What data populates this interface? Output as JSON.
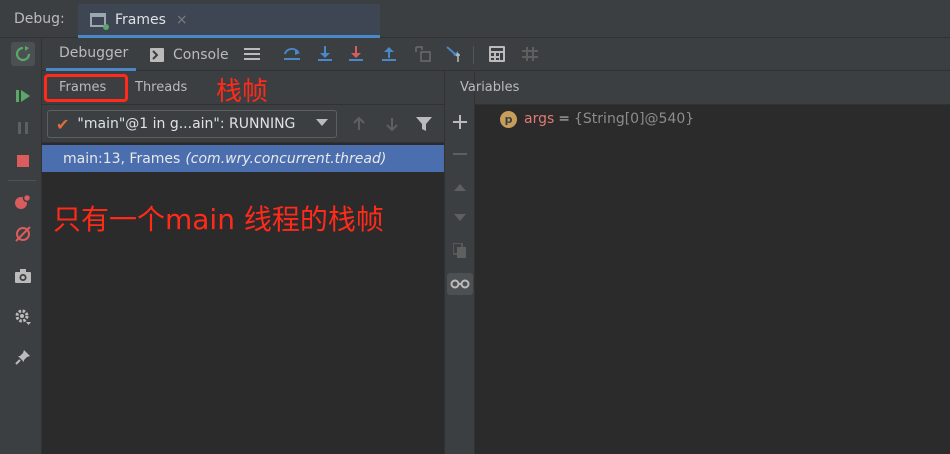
{
  "window": {
    "debug_label": "Debug:",
    "tab_label": "Frames",
    "tab_close": "×"
  },
  "left_toolbar": {
    "icons": [
      "rerun-icon",
      "resume-icon",
      "pause-icon",
      "stop-icon",
      "view-breakpoints-icon",
      "mute-breakpoints-icon",
      "camera-icon",
      "settings-icon",
      "pin-icon"
    ]
  },
  "toolbar": {
    "tabs": [
      {
        "label": "Debugger",
        "selected": true
      },
      {
        "label": "Console",
        "selected": false
      }
    ],
    "action_icons": [
      "step-over-icon",
      "step-into-icon",
      "force-step-into-icon",
      "step-out-icon",
      "drop-frame-icon",
      "run-to-cursor-icon",
      "evaluate-icon",
      "trace-icon"
    ]
  },
  "frames_panel": {
    "subtabs": [
      {
        "label": "Frames",
        "highlighted": true
      },
      {
        "label": "Threads",
        "highlighted": false
      }
    ],
    "annotation_title": "栈帧",
    "thread_selector": {
      "value": "\"main\"@1 in g...ain\": RUNNING"
    },
    "frames": [
      {
        "method": "main:13, Frames",
        "package": "(com.wry.concurrent.thread)",
        "selected": true
      }
    ],
    "annotation_body": "只有一个main 线程的栈帧"
  },
  "variables_panel": {
    "title": "Variables",
    "items": [
      {
        "badge": "p",
        "name": "args",
        "eq": "=",
        "value": "{String[0]@540}"
      }
    ]
  },
  "colors": {
    "accent": "#4a88c7",
    "selection": "#4b6eaf",
    "annotation": "#ff2a1a",
    "var_name": "#e07a74"
  }
}
